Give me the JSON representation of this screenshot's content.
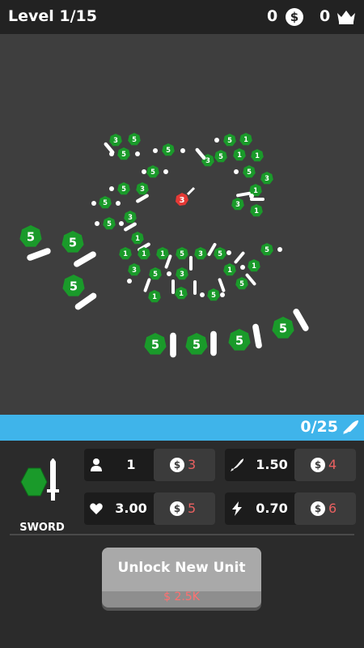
{
  "header": {
    "level_text": "Level 1/15",
    "coins": "0",
    "coin_symbol": "$",
    "crowns": "0"
  },
  "field": {
    "enemy_hp": "3",
    "colors": {
      "ally": "#1a9a2a",
      "enemy": "#e53935",
      "weapon": "#ffffff",
      "field_bg": "#3e3e3e"
    }
  },
  "progress": {
    "text": "0/25",
    "color": "#3fb4ea"
  },
  "unit": {
    "name": "SWORD"
  },
  "stats": {
    "count": {
      "value": "1",
      "cost": "3"
    },
    "damage": {
      "value": "1.50",
      "cost": "4"
    },
    "health": {
      "value": "3.00",
      "cost": "5"
    },
    "speed": {
      "value": "0.70",
      "cost": "6"
    }
  },
  "unlock": {
    "label": "Unlock New Unit",
    "price": "$ 2.5K"
  }
}
